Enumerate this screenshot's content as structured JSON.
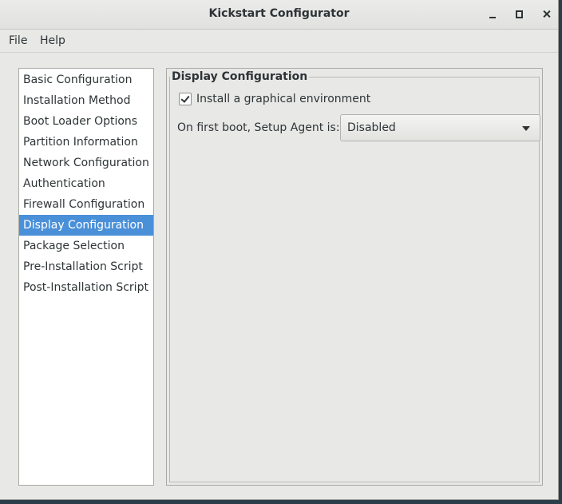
{
  "window": {
    "title": "Kickstart Configurator"
  },
  "menubar": {
    "file": "File",
    "help": "Help"
  },
  "sidebar": {
    "items": [
      {
        "label": "Basic Configuration"
      },
      {
        "label": "Installation Method"
      },
      {
        "label": "Boot Loader Options"
      },
      {
        "label": "Partition Information"
      },
      {
        "label": "Network Configuration"
      },
      {
        "label": "Authentication"
      },
      {
        "label": "Firewall Configuration"
      },
      {
        "label": "Display Configuration",
        "selected": true
      },
      {
        "label": "Package Selection"
      },
      {
        "label": "Pre-Installation Script"
      },
      {
        "label": "Post-Installation Script"
      }
    ]
  },
  "display": {
    "section_title": "Display Configuration",
    "install_graphical_label": "Install a graphical environment",
    "install_graphical_checked": true,
    "setup_agent_label": "On first boot, Setup Agent is:",
    "setup_agent_value": "Disabled"
  },
  "colors": {
    "selection": "#4a90d9",
    "window_bg": "#e8e8e7"
  }
}
